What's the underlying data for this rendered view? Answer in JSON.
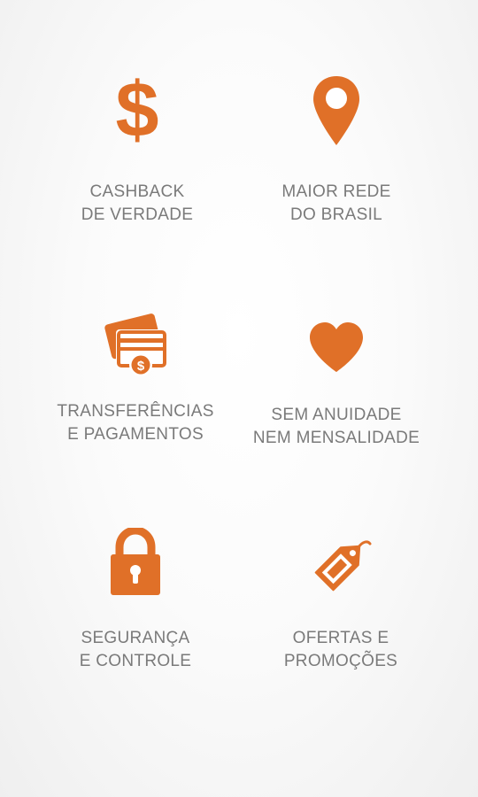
{
  "theme": {
    "accent": "#E07028",
    "text": "#7A7A7A",
    "background": "#F7F7F7"
  },
  "features": [
    {
      "icon": "dollar-icon",
      "line1": "CASHBACK",
      "line2": "DE VERDADE"
    },
    {
      "icon": "map-pin-icon",
      "line1": "MAIOR REDE",
      "line2": "DO BRASIL"
    },
    {
      "icon": "cards-payment-icon",
      "line1": "TRANSFERÊNCIAS",
      "line2": "E PAGAMENTOS"
    },
    {
      "icon": "heart-icon",
      "line1": "SEM ANUIDADE",
      "line2": "NEM MENSALIDADE"
    },
    {
      "icon": "padlock-icon",
      "line1": "SEGURANÇA",
      "line2": "E CONTROLE"
    },
    {
      "icon": "price-tag-icon",
      "line1": "OFERTAS E",
      "line2": "PROMOÇÕES"
    }
  ]
}
